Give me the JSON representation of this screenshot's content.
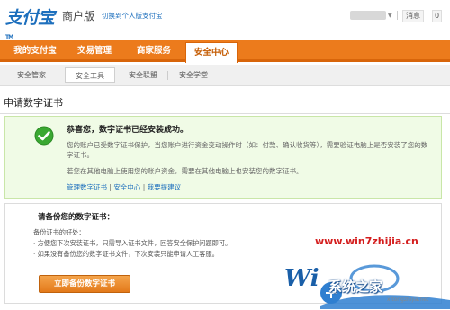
{
  "header": {
    "logo_text": "支付宝",
    "logo_tm": "TM",
    "edition": "商户版",
    "switch_link": "切换到个人版支付宝",
    "messages_label": "消息",
    "messages_count": "0"
  },
  "nav": {
    "tabs": [
      {
        "label": "我的支付宝"
      },
      {
        "label": "交易管理"
      },
      {
        "label": "商家服务"
      },
      {
        "label": "安全中心"
      }
    ],
    "active_index": 3
  },
  "subnav": {
    "tabs": [
      {
        "label": "安全管家"
      },
      {
        "label": "安全工具"
      },
      {
        "label": "安全联盟"
      },
      {
        "label": "安全学堂"
      }
    ],
    "active_index": 1
  },
  "page_title": "申请数字证书",
  "success": {
    "title": "恭喜您，数字证书已经安装成功。",
    "text1": "您的账户已受数字证书保护，当您账户进行资金变动操作时（如：付款、确认收货等），需要验证电脑上是否安装了您的数字证书。",
    "text2": "若您在其他电脑上使用您的账户资金，需要在其他电脑上也安装您的数字证书。",
    "links": {
      "manage": "管理数字证书",
      "security_center": "安全中心",
      "feedback": "我要提建议",
      "separator": "|"
    }
  },
  "backup": {
    "title": "请备份您的数字证书：",
    "benefits_label": "备份证书的好处：",
    "benefit1": "· 方便您下次安装证书，只需导入证书文件，回答安全保护问题即可。",
    "benefit2": "· 如果没有备份您的数字证书文件，下次安装只能申请人工客服。",
    "button_label": "立即备份数字证书"
  },
  "watermark": {
    "url": "www.win7zhijia.cn",
    "site": "系统之家",
    "small": "xitongzhijia.net"
  },
  "colors": {
    "brand_blue": "#1d6fbd",
    "nav_orange": "#ec7b1c",
    "success_bg": "#f0fbe6",
    "check_green": "#3aa832",
    "button_orange": "#e3791a",
    "watermark_red": "#d41e1e"
  }
}
